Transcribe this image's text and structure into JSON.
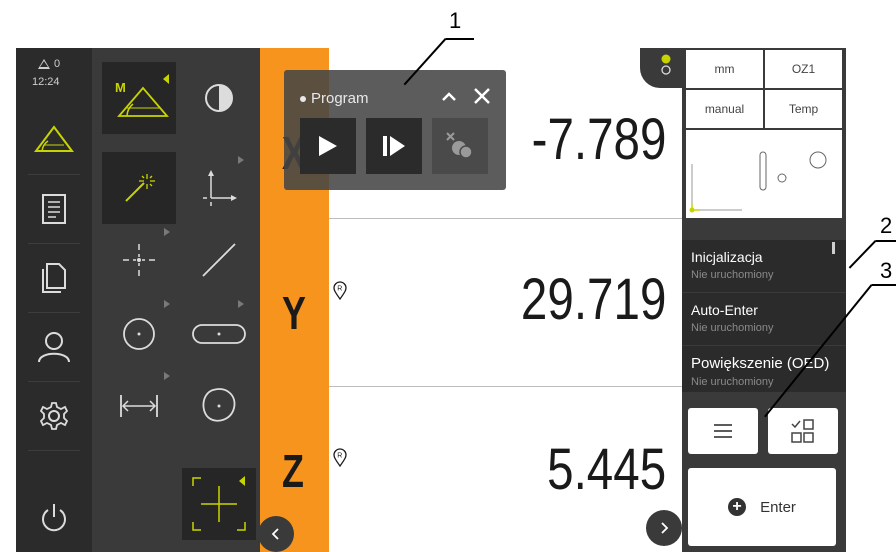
{
  "status": {
    "warning_count": "0",
    "time": "12:24"
  },
  "program_popup": {
    "title": "Program"
  },
  "axes": [
    {
      "letter": "X",
      "value": "-7.789"
    },
    {
      "letter": "Y",
      "value": "29.719"
    },
    {
      "letter": "Z",
      "value": "5.445"
    }
  ],
  "settings": {
    "unit": "mm",
    "ref": "OZ1",
    "mode": "manual",
    "temp": "Temp"
  },
  "steps": [
    {
      "title": "Inicjalizacja",
      "status": "Nie uruchomiony"
    },
    {
      "title": "Auto-Enter",
      "status": "Nie uruchomiony"
    },
    {
      "title": "Powiększenie (OED)",
      "status": "Nie uruchomiony"
    }
  ],
  "enter_label": "Enter",
  "callouts": [
    "1",
    "2",
    "3"
  ],
  "colors": {
    "accent_orange": "#f7941d",
    "geometry_green": "#c8d400",
    "sidebar": "#2b2b2b",
    "palette": "#3a3a3a"
  }
}
